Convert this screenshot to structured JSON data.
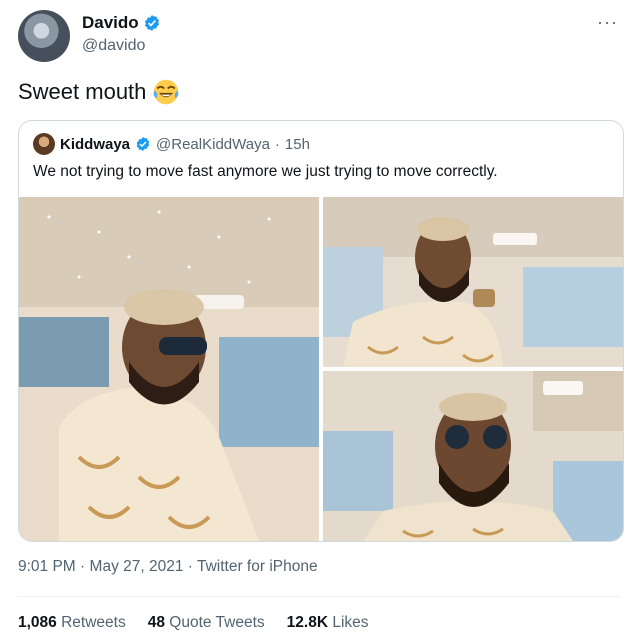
{
  "author": {
    "display_name": "Davido",
    "handle": "@davido"
  },
  "more_label": "···",
  "tweet": {
    "text": "Sweet mouth",
    "emoji": "face-with-tears-of-joy"
  },
  "quoted_tweet": {
    "display_name": "Kiddwaya",
    "handle": "@RealKiddWaya",
    "separator": "·",
    "time": "15h",
    "text": "We not trying to move fast anymore we  just trying to move correctly.",
    "photos": [
      "photo-1",
      "photo-2",
      "photo-3"
    ]
  },
  "meta": {
    "time": "9:01 PM",
    "sep1": "·",
    "date": "May 27, 2021",
    "sep2": "·",
    "source": "Twitter for iPhone"
  },
  "stats": {
    "retweets_count": "1,086",
    "retweets_label": "Retweets",
    "quotes_count": "48",
    "quotes_label": "Quote Tweets",
    "likes_count": "12.8K",
    "likes_label": "Likes"
  },
  "colors": {
    "verified": "#1d9bf0",
    "secondary_text": "#536471",
    "border": "#cfd9de"
  }
}
